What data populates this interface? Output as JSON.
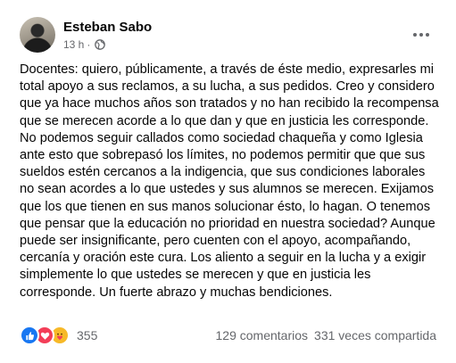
{
  "post": {
    "author": "Esteban Sabo",
    "time": "13 h",
    "separator": "·",
    "audience_icon": "globe-icon",
    "more_icon": "more-options-icon",
    "text": "Docentes: quiero, públicamente, a través de éste medio, expresarles mi total apoyo a sus reclamos, a su lucha, a sus pedidos. Creo y considero que ya hace muchos años son tratados y no han recibido la recompensa que se merecen acorde a lo que dan y que en justicia les corresponde. No podemos seguir callados como sociedad chaqueña y como Iglesia ante esto que sobrepasó los límites, no podemos permitir que que sus sueldos estén cercanos a la indigencia, que sus condiciones laborales no sean acordes a lo que ustedes y sus alumnos se merecen. Exijamos que los que tienen en sus manos solucionar ésto, lo hagan. O tenemos que pensar que la educación no prioridad en nuestra sociedad? Aunque puede ser insignificante, pero cuenten con el apoyo, acompañando, cercanía y oración este cura. Los aliento a seguir en la lucha y a exigir simplemente lo que ustedes se merecen y que en justicia les corresponde. Un fuerte abrazo y muchas bendiciones."
  },
  "stats": {
    "reaction_icons": [
      "like-icon",
      "love-icon",
      "care-icon"
    ],
    "reaction_count": "355",
    "comments": "129 comentarios",
    "shares": "331 veces compartida"
  },
  "colors": {
    "like": "#1877f2",
    "love": "#f33e58",
    "care": "#f7b928",
    "secondary_text": "#65676b",
    "primary_text": "#050505"
  }
}
